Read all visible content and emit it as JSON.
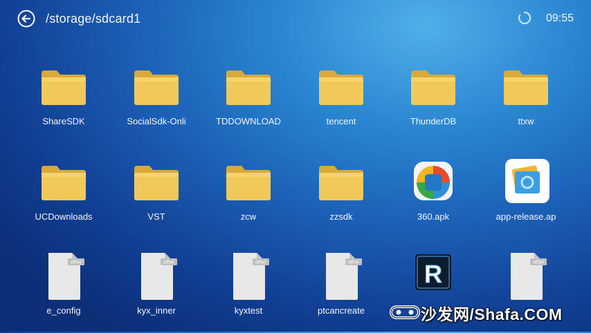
{
  "header": {
    "path": "/storage/sdcard1",
    "time": "09:55",
    "back_icon": "back-arrow-icon",
    "loading_icon": "spinner-icon"
  },
  "files": [
    {
      "name": "ShareSDK",
      "type": "folder"
    },
    {
      "name": "SocialSdk-Onli",
      "type": "folder"
    },
    {
      "name": "TDDOWNLOAD",
      "type": "folder"
    },
    {
      "name": "tencent",
      "type": "folder"
    },
    {
      "name": "ThunderDB",
      "type": "folder"
    },
    {
      "name": "ttxw",
      "type": "folder"
    },
    {
      "name": "UCDownloads",
      "type": "folder"
    },
    {
      "name": "VST",
      "type": "folder"
    },
    {
      "name": "zcw",
      "type": "folder"
    },
    {
      "name": "zzsdk",
      "type": "folder"
    },
    {
      "name": "360.apk",
      "type": "apk-360"
    },
    {
      "name": "app-release.ap",
      "type": "apk-app"
    },
    {
      "name": "e_config",
      "type": "other",
      "badge": "other"
    },
    {
      "name": "kyx_inner",
      "type": "other",
      "badge": "other"
    },
    {
      "name": "kyxtest",
      "type": "other",
      "badge": "other"
    },
    {
      "name": "ptcancreate",
      "type": "other",
      "badge": "other"
    },
    {
      "name": "",
      "type": "apk-r"
    },
    {
      "name": "",
      "type": "other",
      "badge": "other"
    }
  ],
  "watermark": {
    "text": "沙发网/Shafa.COM"
  },
  "colors": {
    "folder": "#f1c95a",
    "folder_dark": "#d9a93a",
    "file": "#e8e8e8"
  }
}
